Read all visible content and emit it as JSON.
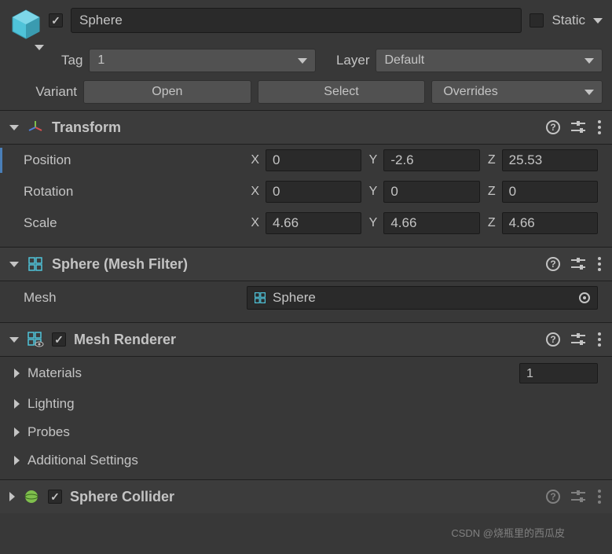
{
  "header": {
    "name": "Sphere",
    "static_label": "Static",
    "active": true,
    "static_checked": false
  },
  "tag_row": {
    "tag_label": "Tag",
    "tag_value": "1",
    "layer_label": "Layer",
    "layer_value": "Default"
  },
  "variant_row": {
    "label": "Variant",
    "open": "Open",
    "select": "Select",
    "overrides": "Overrides"
  },
  "transform": {
    "title": "Transform",
    "position": {
      "label": "Position",
      "x": "0",
      "y": "-2.6",
      "z": "25.53"
    },
    "rotation": {
      "label": "Rotation",
      "x": "0",
      "y": "0",
      "z": "0"
    },
    "scale": {
      "label": "Scale",
      "x": "4.66",
      "y": "4.66",
      "z": "4.66"
    }
  },
  "mesh_filter": {
    "title": "Sphere (Mesh Filter)",
    "mesh_label": "Mesh",
    "mesh_value": "Sphere"
  },
  "mesh_renderer": {
    "title": "Mesh Renderer",
    "enabled": true,
    "materials": {
      "label": "Materials",
      "count": "1"
    },
    "lighting": "Lighting",
    "probes": "Probes",
    "additional": "Additional Settings"
  },
  "sphere_collider": {
    "title": "Sphere Collider",
    "enabled": true
  },
  "axis": {
    "x": "X",
    "y": "Y",
    "z": "Z"
  },
  "watermark": "CSDN @烧瓶里的西瓜皮"
}
